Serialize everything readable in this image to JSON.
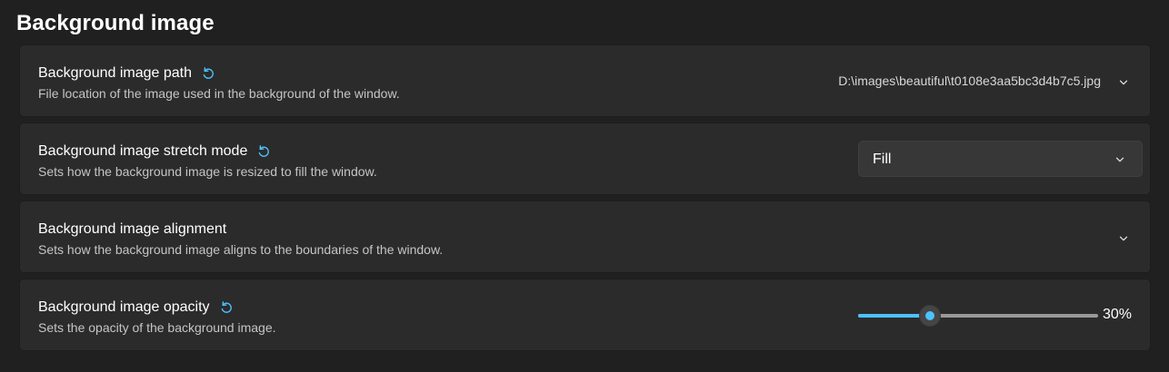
{
  "colors": {
    "background": "#202020",
    "card": "#2b2b2b",
    "accent": "#4cc2ff",
    "description_text": "#c5c5c5"
  },
  "section": {
    "title": "Background image"
  },
  "settings": {
    "path": {
      "title": "Background image path",
      "description": "File location of the image used in the background of the window.",
      "value": "D:\\images\\beautiful\\t0108e3aa5bc3d4b7c5.jpg",
      "reset_icon": "reset-icon",
      "chevron_icon": "chevron-down-icon"
    },
    "stretch": {
      "title": "Background image stretch mode",
      "description": "Sets how the background image is resized to fill the window.",
      "selected": "Fill",
      "reset_icon": "reset-icon",
      "chevron_icon": "chevron-down-icon"
    },
    "alignment": {
      "title": "Background image alignment",
      "description": "Sets how the background image aligns to the boundaries of the window.",
      "chevron_icon": "chevron-down-icon"
    },
    "opacity": {
      "title": "Background image opacity",
      "description": "Sets the opacity of the background image.",
      "value_label": "30%",
      "value": 0.3,
      "reset_icon": "reset-icon"
    }
  }
}
